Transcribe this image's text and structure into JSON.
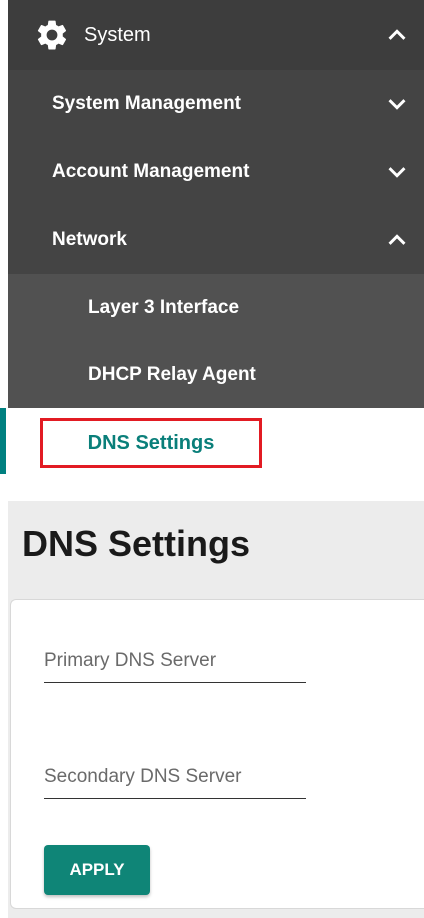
{
  "sidebar": {
    "system": {
      "label": "System",
      "icon": "gear-icon",
      "expanded": true
    },
    "items": [
      {
        "label": "System Management",
        "icon": "chevron-down-icon"
      },
      {
        "label": "Account Management",
        "icon": "chevron-down-icon"
      },
      {
        "label": "Network",
        "icon": "chevron-up-icon",
        "expanded": true
      }
    ],
    "network_children": [
      {
        "label": "Layer 3 Interface"
      },
      {
        "label": "DHCP Relay Agent"
      },
      {
        "label": "DNS Settings",
        "active": true
      }
    ]
  },
  "main": {
    "title": "DNS Settings",
    "primary_dns": {
      "placeholder": "Primary DNS Server",
      "value": ""
    },
    "secondary_dns": {
      "placeholder": "Secondary DNS Server",
      "value": ""
    },
    "apply_label": "APPLY"
  },
  "colors": {
    "nav_dark": "#3d3d3d",
    "nav_mid": "#444444",
    "nav_light": "#515151",
    "accent": "#0f8577",
    "highlight_border": "#e21b23"
  }
}
